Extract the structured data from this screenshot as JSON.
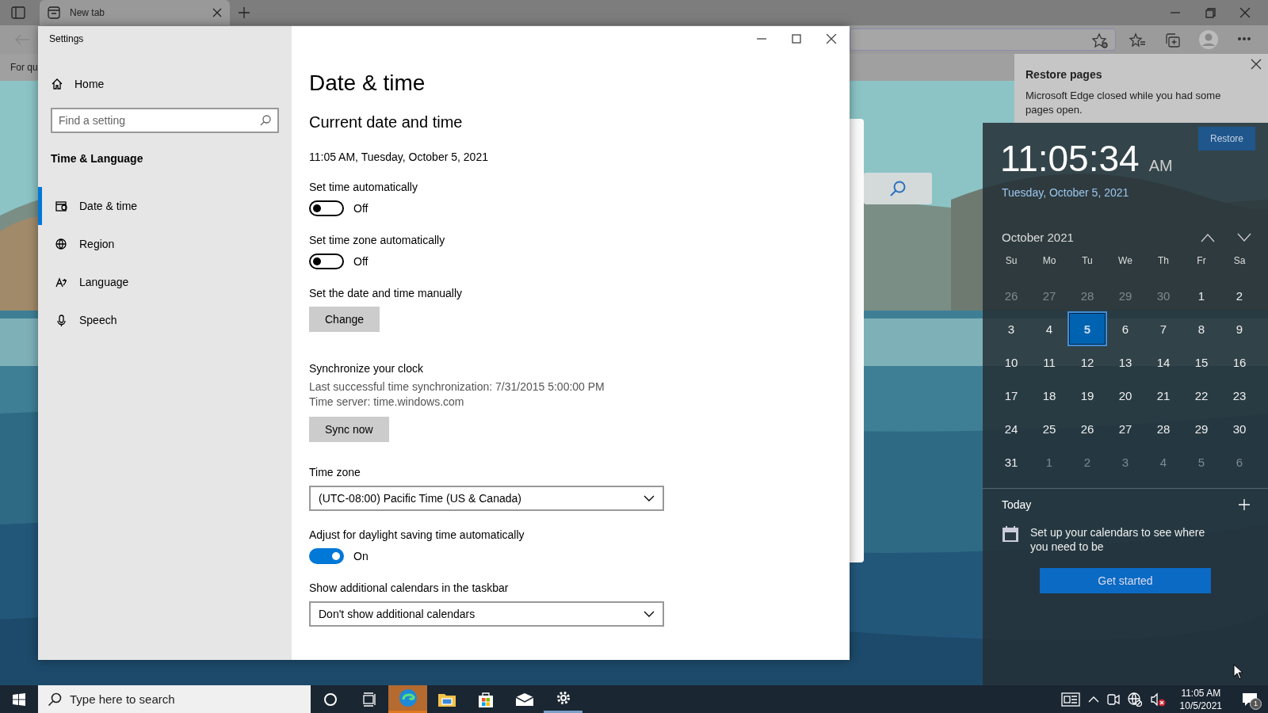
{
  "browser": {
    "tab_title": "New tab",
    "favorites_text": "For qu"
  },
  "restore_popup": {
    "title": "Restore pages",
    "message": "Microsoft Edge closed while you had some pages open.",
    "button": "Restore"
  },
  "settings": {
    "title": "Settings",
    "sidebar": {
      "home": "Home",
      "search_placeholder": "Find a setting",
      "section": "Time & Language",
      "items": [
        {
          "label": "Date & time",
          "selected": true
        },
        {
          "label": "Region",
          "selected": false
        },
        {
          "label": "Language",
          "selected": false
        },
        {
          "label": "Speech",
          "selected": false
        }
      ]
    },
    "content": {
      "heading": "Date & time",
      "subheading": "Current date and time",
      "current": "11:05 AM, Tuesday, October 5, 2021",
      "rows": [
        {
          "kind": "toggle",
          "label": "Set time automatically",
          "on": false,
          "state_text": "Off"
        },
        {
          "kind": "toggle",
          "label": "Set time zone automatically",
          "on": false,
          "state_text": "Off"
        },
        {
          "kind": "button",
          "label": "Set the date and time manually",
          "button": "Change"
        },
        {
          "kind": "sync",
          "label": "Synchronize your clock",
          "lines": [
            "Last successful time synchronization: 7/31/2015 5:00:00 PM",
            "Time server: time.windows.com"
          ],
          "button": "Sync now"
        },
        {
          "kind": "dropdown",
          "label": "Time zone",
          "value": "(UTC-08:00) Pacific Time (US & Canada)"
        },
        {
          "kind": "toggle",
          "label": "Adjust for daylight saving time automatically",
          "on": true,
          "state_text": "On"
        },
        {
          "kind": "dropdown",
          "label": "Show additional calendars in the taskbar",
          "value": "Don't show additional calendars"
        }
      ]
    }
  },
  "clock": {
    "time": "11:05:34",
    "ampm": "AM",
    "date": "Tuesday, October 5, 2021"
  },
  "calendar": {
    "month": "October 2021",
    "weekdays": [
      "Su",
      "Mo",
      "Tu",
      "We",
      "Th",
      "Fr",
      "Sa"
    ],
    "days": [
      {
        "day": "26",
        "in_month": false,
        "selected": false
      },
      {
        "day": "27",
        "in_month": false,
        "selected": false
      },
      {
        "day": "28",
        "in_month": false,
        "selected": false
      },
      {
        "day": "29",
        "in_month": false,
        "selected": false
      },
      {
        "day": "30",
        "in_month": false,
        "selected": false
      },
      {
        "day": "1",
        "in_month": true,
        "selected": false
      },
      {
        "day": "2",
        "in_month": true,
        "selected": false
      },
      {
        "day": "3",
        "in_month": true,
        "selected": false
      },
      {
        "day": "4",
        "in_month": true,
        "selected": false
      },
      {
        "day": "5",
        "in_month": true,
        "selected": true
      },
      {
        "day": "6",
        "in_month": true,
        "selected": false
      },
      {
        "day": "7",
        "in_month": true,
        "selected": false
      },
      {
        "day": "8",
        "in_month": true,
        "selected": false
      },
      {
        "day": "9",
        "in_month": true,
        "selected": false
      },
      {
        "day": "10",
        "in_month": true,
        "selected": false
      },
      {
        "day": "11",
        "in_month": true,
        "selected": false
      },
      {
        "day": "12",
        "in_month": true,
        "selected": false
      },
      {
        "day": "13",
        "in_month": true,
        "selected": false
      },
      {
        "day": "14",
        "in_month": true,
        "selected": false
      },
      {
        "day": "15",
        "in_month": true,
        "selected": false
      },
      {
        "day": "16",
        "in_month": true,
        "selected": false
      },
      {
        "day": "17",
        "in_month": true,
        "selected": false
      },
      {
        "day": "18",
        "in_month": true,
        "selected": false
      },
      {
        "day": "19",
        "in_month": true,
        "selected": false
      },
      {
        "day": "20",
        "in_month": true,
        "selected": false
      },
      {
        "day": "21",
        "in_month": true,
        "selected": false
      },
      {
        "day": "22",
        "in_month": true,
        "selected": false
      },
      {
        "day": "23",
        "in_month": true,
        "selected": false
      },
      {
        "day": "24",
        "in_month": true,
        "selected": false
      },
      {
        "day": "25",
        "in_month": true,
        "selected": false
      },
      {
        "day": "26",
        "in_month": true,
        "selected": false
      },
      {
        "day": "27",
        "in_month": true,
        "selected": false
      },
      {
        "day": "28",
        "in_month": true,
        "selected": false
      },
      {
        "day": "29",
        "in_month": true,
        "selected": false
      },
      {
        "day": "30",
        "in_month": true,
        "selected": false
      },
      {
        "day": "31",
        "in_month": true,
        "selected": false
      },
      {
        "day": "1",
        "in_month": false,
        "selected": false
      },
      {
        "day": "2",
        "in_month": false,
        "selected": false
      },
      {
        "day": "3",
        "in_month": false,
        "selected": false
      },
      {
        "day": "4",
        "in_month": false,
        "selected": false
      },
      {
        "day": "5",
        "in_month": false,
        "selected": false
      },
      {
        "day": "6",
        "in_month": false,
        "selected": false
      }
    ]
  },
  "agenda": {
    "heading": "Today",
    "message": "Set up your calendars to see where you need to be",
    "button": "Get started"
  },
  "taskbar": {
    "search_placeholder": "Type here to search",
    "time": "11:05 AM",
    "date": "10/5/2021",
    "notification_count": "1"
  }
}
